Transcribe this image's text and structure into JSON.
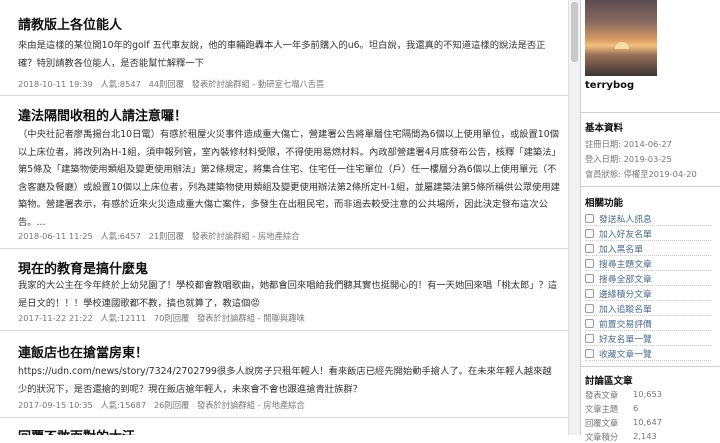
{
  "posts": [
    {
      "title": "請教版上各位能人",
      "body": "來由是這樣的某位開10年的golf 五代車友說，他的車輛跑轟本人一年多前購入的u6。坦白說，我還真的不知道這樣的說法是否正確？特別請教各位能人，是否能幫忙解釋一下",
      "date": "2018-10-11 19:39",
      "views": "人氣:8547",
      "replies": "44則回覆",
      "category": "發表於討論群組 - 動研室七嘴八舌區"
    },
    {
      "title": "違法隔間收租的人請注意囉！",
      "body": "（中央社記者廖禹揚台北10日電）有感於租屋火災事件造成重大傷亡，營建署公告將單層住宅隔間為6個以上使用單位，或設置10個以上床位者，將改列為H-1組，須申報列管，室內裝修材料受限，不得使用易燃材料。內政部營建署4月底發布公告，核釋「建築法」第5條及「建築物使用類組及變更使用辦法」第2條規定，將集合住宅、住宅任一住宅單位（戶）任一樓層分為6個以上使用單元（不含客廳及餐廳）或設置10個以上床位者，列為建築物使用類組及變更使用辦法第2條所定H-1組，並屬建築法第5條所稱供公眾使用建築物。營建署表示，有感於近來火災造成重大傷亡案件，多發生在出租民宅，而非過去較受注意的公共場所，因此決定發布這次公告。...",
      "date": "2018-06-11 11:25",
      "views": "人氣:6457",
      "replies": "21則回覆",
      "category": "發表於討論群組 - 房地產綜合"
    },
    {
      "title": "現在的教育是搞什麼鬼",
      "body": "我家的大公主在今年終於上幼兒園了！學校都會教唱歌曲，她都會回來唱給我們聽其實也挺開心的！有一天她回來唱「桃太郎」？這是日文的！！！學校連國歌都不教，搞也就算了，教這個😡",
      "date": "2017-11-22 21:22",
      "views": "人氣:12111",
      "replies": "70則回覆",
      "category": "發表於討論群組 - 閒聊與趣味"
    },
    {
      "title": "連飯店也在搶當房東！",
      "body": "https://udn.com/news/story/7324/2702799很多人說房子只租年輕人！看來飯店已經先開始動手搶人了。在未來年輕人越來越少的狀況下，是否還搶的到呢？現在飯店搶年輕人，未來會不會也跟進搶青壯族群？",
      "date": "2017-09-15 10:35",
      "views": "人氣:15687",
      "replies": "26則回覆",
      "category": "發表於討論群組 - 房地產綜合"
    },
    {
      "title": "回覆不敢面對的大汗"
    }
  ],
  "sidebar": {
    "username": "terrybog",
    "profile": {
      "heading": "基本資料",
      "rows": [
        "註冊日期: 2014-06-27",
        "登入日期: 2019-03-25",
        "會員狀態: 停權至2019-04-20"
      ]
    },
    "functions": {
      "heading": "相關功能",
      "items": [
        "發送私人訊息",
        "加入好友名單",
        "加入黑名單",
        "搜尋主題文章",
        "搜尋全部文章",
        "邊緣積分文章",
        "加入追蹤名單",
        "前置交易評價",
        "好友名單一覽",
        "收藏文章一覽"
      ]
    },
    "stats": {
      "heading": "討論區文章",
      "rows": [
        {
          "label": "發表文章",
          "value": "10,653"
        },
        {
          "label": "文章主題",
          "value": "6"
        },
        {
          "label": "回覆文章",
          "value": "10,647"
        },
        {
          "label": "文章積分",
          "value": "2,143"
        }
      ]
    }
  }
}
